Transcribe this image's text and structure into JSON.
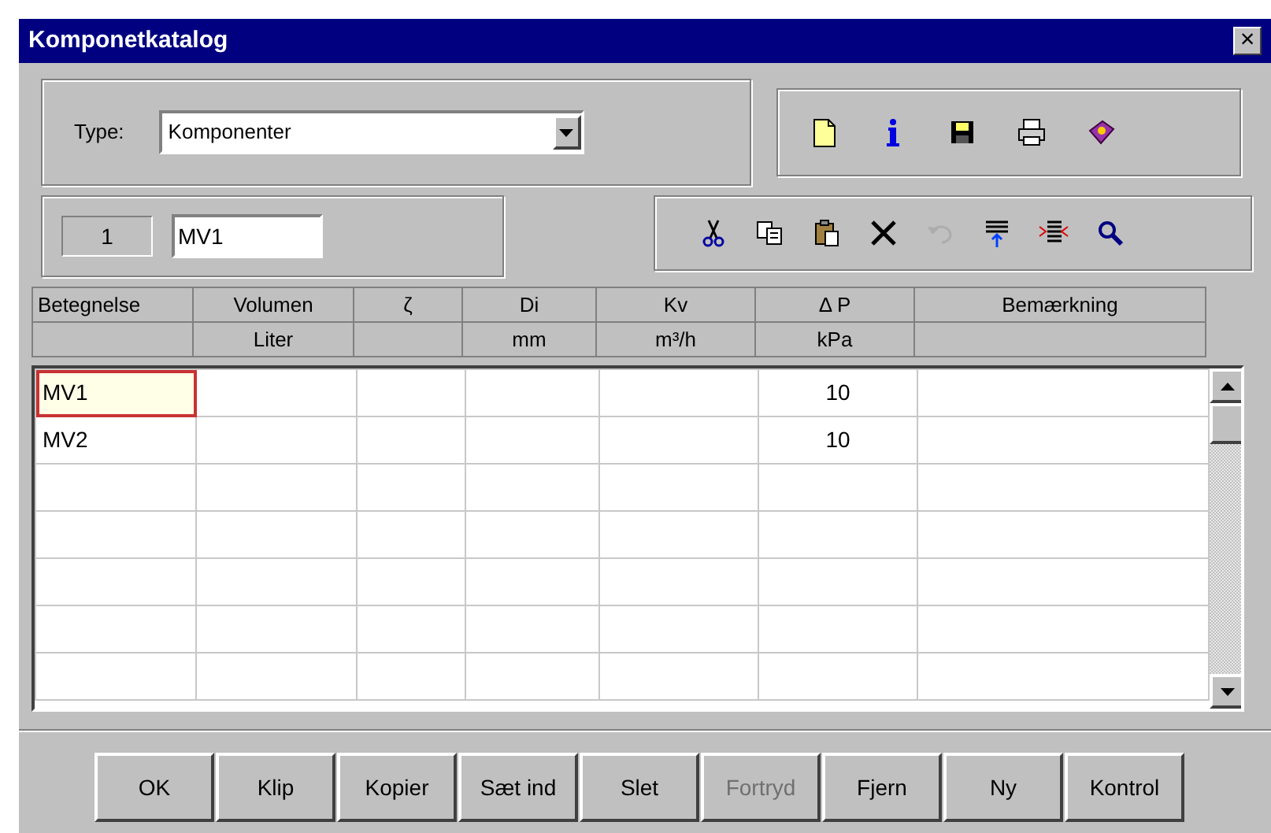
{
  "window": {
    "title": "Komponetkatalog",
    "close": "×"
  },
  "type_field": {
    "label": "Type:",
    "value": "Komponenter"
  },
  "main_toolbar": [
    {
      "kind": "new",
      "disabled": false
    },
    {
      "kind": "info",
      "disabled": false
    },
    {
      "kind": "save",
      "disabled": false
    },
    {
      "kind": "print",
      "disabled": false
    },
    {
      "kind": "help",
      "disabled": false
    }
  ],
  "record": {
    "number": "1",
    "name": "MV1"
  },
  "edit_toolbar": [
    {
      "kind": "cut",
      "disabled": false
    },
    {
      "kind": "copy",
      "disabled": false
    },
    {
      "kind": "paste",
      "disabled": false
    },
    {
      "kind": "delete",
      "disabled": false
    },
    {
      "kind": "undo",
      "disabled": true
    },
    {
      "kind": "insert",
      "disabled": false
    },
    {
      "kind": "remove",
      "disabled": false
    },
    {
      "kind": "search",
      "disabled": false
    }
  ],
  "table": {
    "columns": [
      {
        "title": "Betegnelse"
      },
      {
        "title": "Volumen",
        "unit": "Liter"
      },
      {
        "title": "ζ"
      },
      {
        "title": "Di",
        "unit": "mm"
      },
      {
        "title": "Kv",
        "unit": "m³/h"
      },
      {
        "title": "Δ P",
        "unit": "kPa"
      },
      {
        "title": "Bemærkning"
      }
    ],
    "rows": [
      {
        "betegnelse": "MV1",
        "delta_p": "10",
        "focused": true
      },
      {
        "betegnelse": "MV2",
        "delta_p": "10",
        "focused": false
      }
    ]
  },
  "buttons": [
    {
      "label": "OK",
      "disabled": false
    },
    {
      "label": "Klip",
      "disabled": false
    },
    {
      "label": "Kopier",
      "disabled": false
    },
    {
      "label": "Sæt ind",
      "disabled": false
    },
    {
      "label": "Slet",
      "disabled": false
    },
    {
      "label": "Fortryd",
      "disabled": true
    },
    {
      "label": "Fjern",
      "disabled": false
    },
    {
      "label": "Ny",
      "disabled": false
    },
    {
      "label": "Kontrol",
      "disabled": false
    }
  ]
}
